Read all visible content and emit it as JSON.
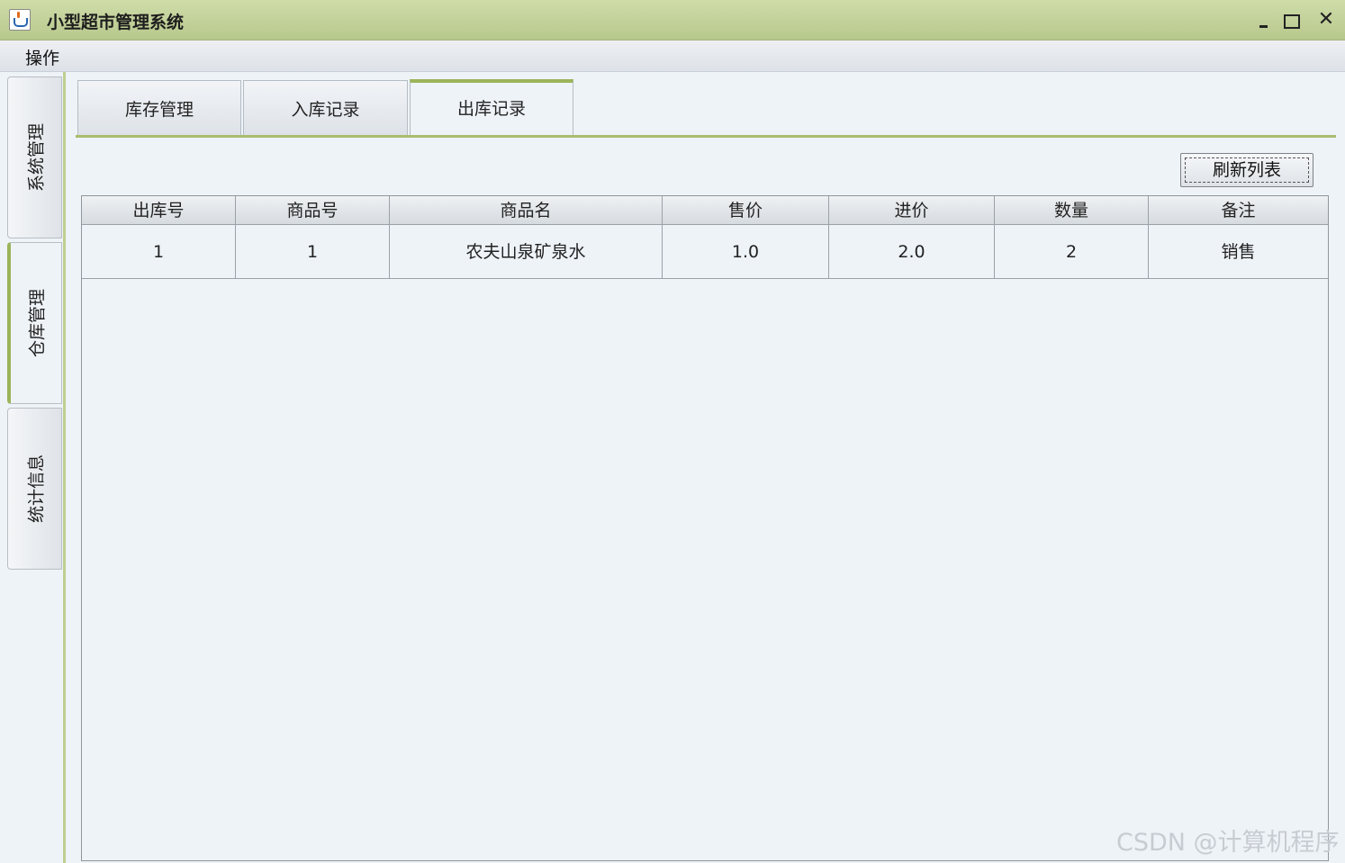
{
  "window": {
    "title": "小型超市管理系统",
    "controls": {
      "minimize": "minimize-icon",
      "maximize": "maximize-icon",
      "close": "✕"
    }
  },
  "menubar": {
    "items": [
      {
        "label": "操作"
      }
    ]
  },
  "side_tabs": [
    {
      "label": "系统管理",
      "active": false
    },
    {
      "label": "仓库管理",
      "active": true
    },
    {
      "label": "统计信息",
      "active": false
    }
  ],
  "tabs": [
    {
      "label": "库存管理",
      "active": false
    },
    {
      "label": "入库记录",
      "active": false
    },
    {
      "label": "出库记录",
      "active": true
    }
  ],
  "toolbar": {
    "refresh_label": "刷新列表"
  },
  "table": {
    "columns": [
      "出库号",
      "商品号",
      "商品名",
      "售价",
      "进价",
      "数量",
      "备注"
    ],
    "rows": [
      [
        "1",
        "1",
        "农夫山泉矿泉水",
        "1.0",
        "2.0",
        "2",
        "销售"
      ]
    ]
  },
  "watermark": "CSDN @计算机程序",
  "colors": {
    "accent": "#9bb45a",
    "titlebar": "#c3d29b",
    "background": "#eef3f8"
  }
}
